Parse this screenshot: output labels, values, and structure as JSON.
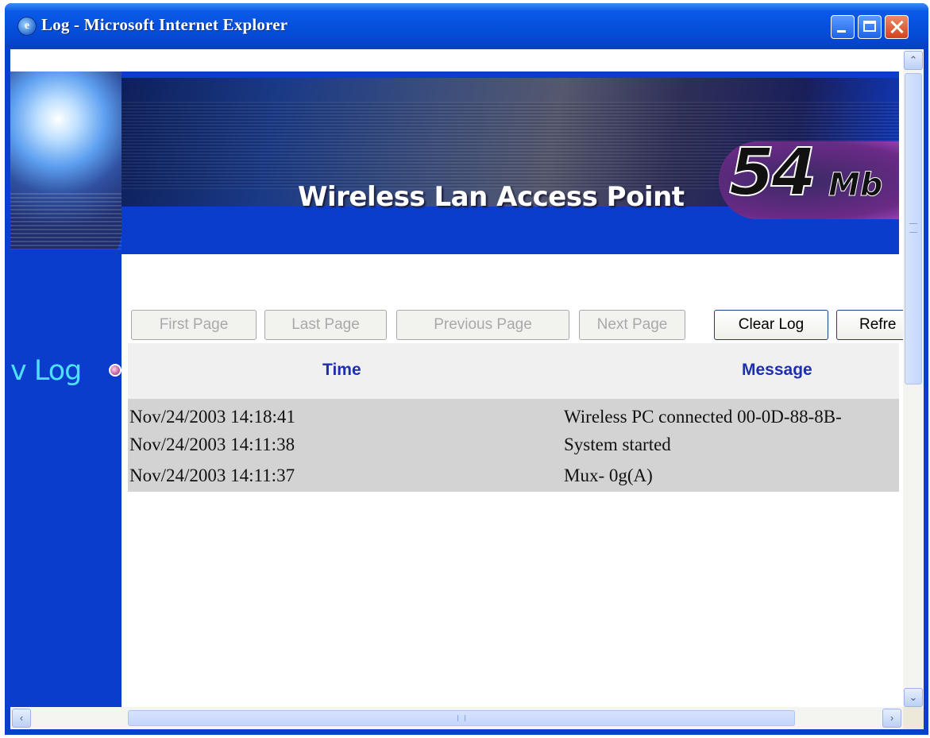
{
  "window": {
    "title": "Log - Microsoft Internet Explorer",
    "icon": "ie-icon",
    "controls": [
      "minimize-icon",
      "maximize-icon",
      "close-icon"
    ]
  },
  "banner": {
    "product_text": "Wireless Lan Access Point",
    "speed_number": "54",
    "speed_unit": "Mb"
  },
  "sidebar": {
    "label": "v Log"
  },
  "toolbar": {
    "first_page": "First Page",
    "last_page": "Last Page",
    "previous_page": "Previous Page",
    "next_page": "Next Page",
    "clear_log": "Clear Log",
    "refresh": "Refre"
  },
  "log_table": {
    "headers": {
      "time": "Time",
      "message": "Message"
    },
    "rows": [
      {
        "time": "Nov/24/2003 14:18:41",
        "message": "Wireless PC connected 00-0D-88-8B-"
      },
      {
        "time": "Nov/24/2003 14:11:38",
        "message": "System started"
      },
      {
        "time": "Nov/24/2003 14:11:37",
        "message": "Mux- 0g(A)"
      }
    ]
  },
  "scrollbars": {
    "vertical_icons": [
      "chevron-up-icon",
      "chevron-down-icon"
    ],
    "horizontal_icons": [
      "chevron-left-icon",
      "chevron-right-icon"
    ]
  },
  "colors": {
    "title_bar": "#0450dc",
    "page_blue": "#0b3dcc",
    "sidebar_label": "#4fe0ff",
    "table_header_text": "#1d2fb0",
    "table_row_bg": "#d3d3d3"
  }
}
